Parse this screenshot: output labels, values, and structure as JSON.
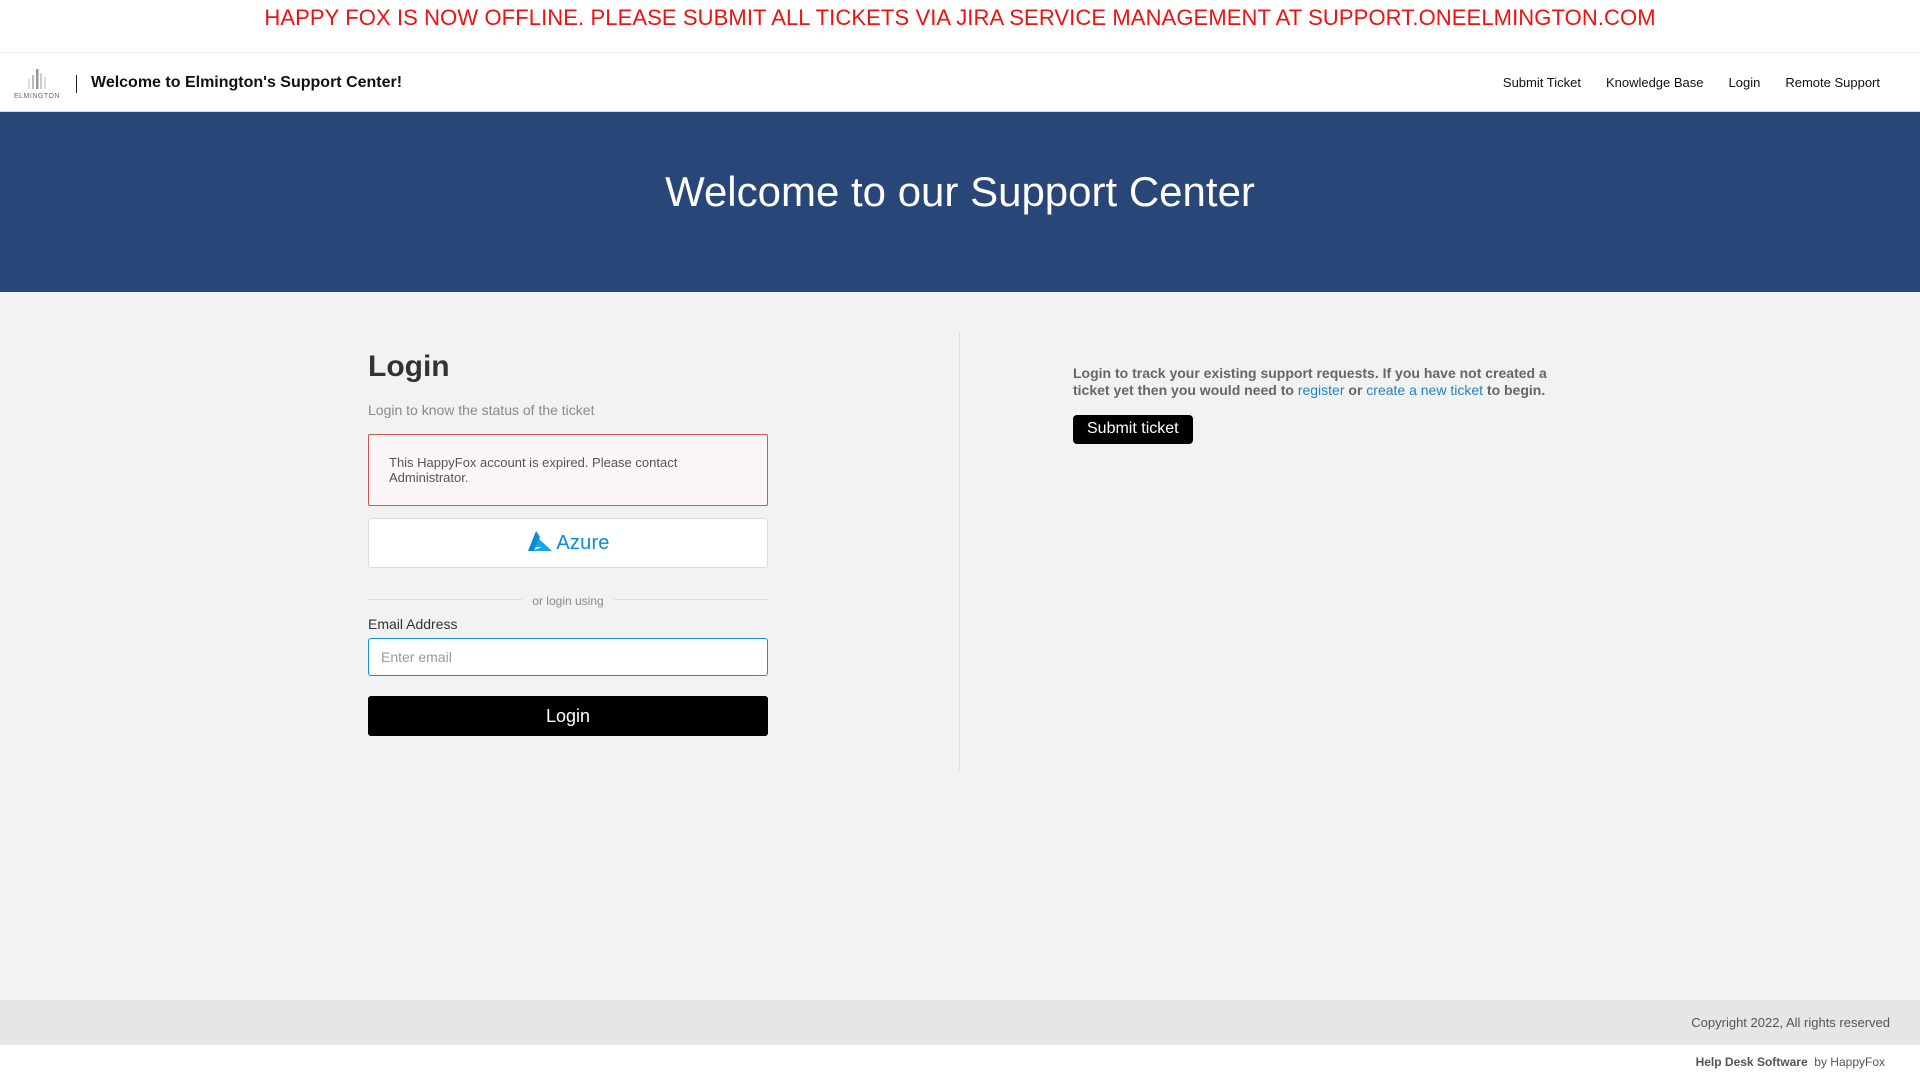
{
  "announcement": "HAPPY FOX IS NOW OFFLINE. PLEASE SUBMIT ALL TICKETS VIA JIRA SERVICE MANAGEMENT AT SUPPORT.ONEELMINGTON.COM",
  "header": {
    "logo_text": "ELMINGTON",
    "site_title": "Welcome to Elmington's Support Center!",
    "nav": [
      "Submit Ticket",
      "Knowledge Base",
      "Login",
      "Remote Support"
    ]
  },
  "hero": {
    "title": "Welcome to our Support Center"
  },
  "login": {
    "heading": "Login",
    "subtitle": "Login to know the status of the ticket",
    "alert": "This HappyFox account is expired. Please contact Administrator.",
    "azure_label": "Azure",
    "divider_text": "or login using",
    "email_label": "Email Address",
    "email_placeholder": "Enter email",
    "email_value": "",
    "submit_label": "Login"
  },
  "info": {
    "text_before": "Login to track your existing support requests. If you have not created a ticket yet then you would need to ",
    "register_link": "register",
    "text_or": " or ",
    "create_link": "create a new ticket",
    "text_after": " to begin.",
    "submit_ticket_label": "Submit ticket"
  },
  "footer": {
    "copyright": "Copyright 2022, All rights reserved",
    "powered_bold": "Help Desk Software",
    "powered_by": "by HappyFox"
  },
  "colors": {
    "announcement": "#ee1111",
    "hero_bg": "#284677",
    "link": "#1f86c0",
    "alert_border": "#d9534f",
    "azure": "#0a8bd6"
  },
  "icons": {
    "azure": "azure-logo-icon",
    "brand": "elmington-logo-icon"
  }
}
